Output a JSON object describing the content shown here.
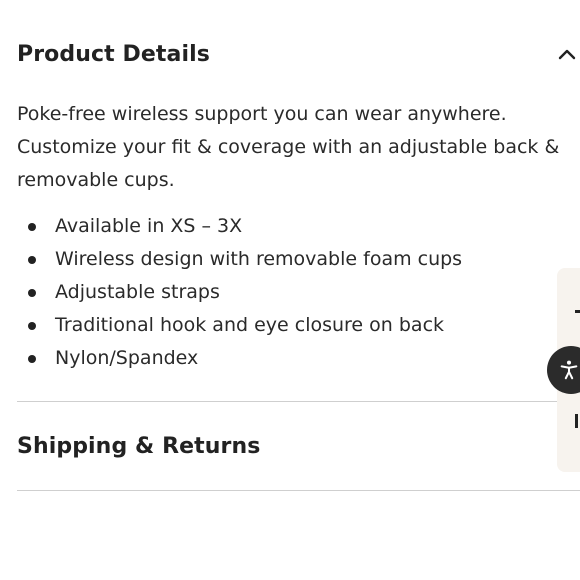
{
  "product_details": {
    "title": "Product Details",
    "expanded": true,
    "description_lines": [
      "Poke-free wireless support you can wear anywhere.",
      "Customize your fit & coverage with an adjustable back &",
      "removable cups."
    ],
    "features": [
      "Available in XS – 3X",
      "Wireless design with removable foam cups",
      "Adjustable straps",
      "Traditional hook and eye closure on back",
      "Nylon/Spandex"
    ]
  },
  "shipping_returns": {
    "title": "Shipping & Returns"
  },
  "icons": {
    "collapse": "chevron-up-icon",
    "accessibility": "accessibility-icon"
  },
  "colors": {
    "text": "#222222",
    "divider": "#cfcfcf",
    "side_panel": "#f7f3ee",
    "accessibility_button": "#2b2b2b"
  }
}
